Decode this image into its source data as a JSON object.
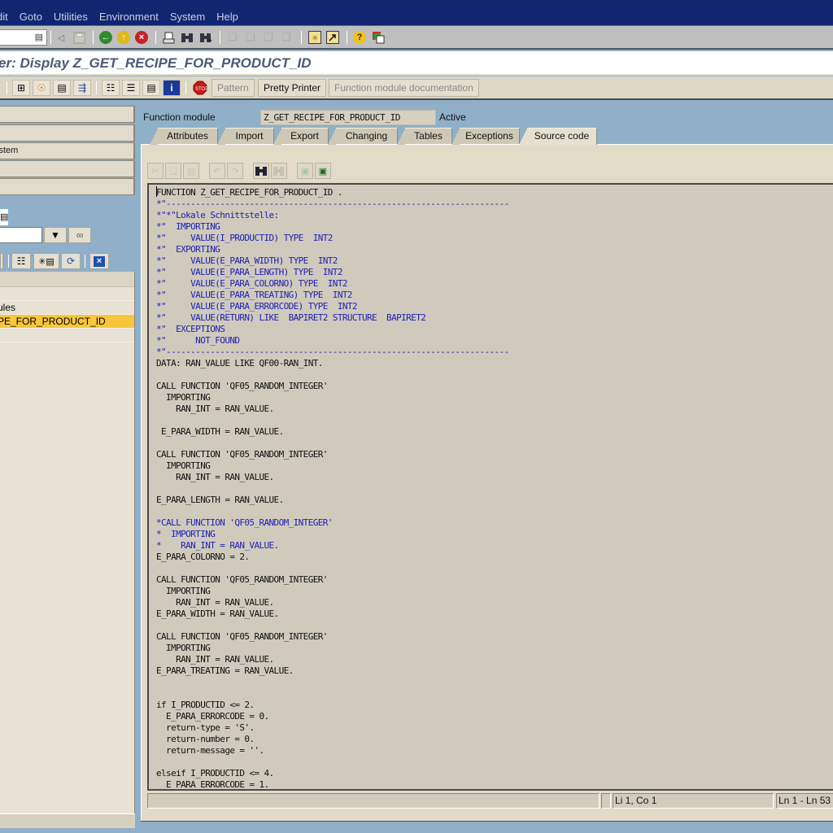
{
  "menubar": {
    "items": [
      "dit",
      "Goto",
      "Utilities",
      "Environment",
      "System",
      "Help"
    ]
  },
  "system_toolbar": {
    "command_field_value": "",
    "icons": [
      "command-dropdown-icon",
      "back-arrow-small-icon",
      "save-icon",
      "back-icon",
      "exit-icon",
      "cancel-icon",
      "print-icon",
      "find-icon",
      "find-next-icon",
      "first-page-icon",
      "previous-page-icon",
      "next-page-icon",
      "last-page-icon",
      "create-session-icon",
      "shortcut-icon",
      "help-icon",
      "layout-menu-icon"
    ]
  },
  "title": "er: Display Z_GET_RECIPE_FOR_PRODUCT_ID",
  "app_toolbar": {
    "buttons": {
      "pattern": "Pattern",
      "pretty_printer": "Pretty Printer",
      "fm_documentation": "Function module documentation"
    }
  },
  "left_panel": {
    "buttons": [
      "",
      "",
      "ystem",
      "",
      ""
    ],
    "tree_rows": [
      {
        "label": "",
        "selected": false
      },
      {
        "label": "ules",
        "selected": false
      },
      {
        "label": "PE_FOR_PRODUCT_ID",
        "selected": true
      },
      {
        "label": "",
        "selected": false
      }
    ],
    "combo_value": ""
  },
  "header": {
    "function_module_label": "Function module",
    "function_module_value": "Z_GET_RECIPE_FOR_PRODUCT_ID",
    "status": "Active"
  },
  "tabs": [
    {
      "label": "Attributes",
      "active": false
    },
    {
      "label": "Import",
      "active": false
    },
    {
      "label": "Export",
      "active": false
    },
    {
      "label": "Changing",
      "active": false
    },
    {
      "label": "Tables",
      "active": false
    },
    {
      "label": "Exceptions",
      "active": false
    },
    {
      "label": "Source code",
      "active": true
    }
  ],
  "source_code": [
    {
      "text": "FUNCTION Z_GET_RECIPE_FOR_PRODUCT_ID .",
      "comment": false
    },
    {
      "text": "*\"----------------------------------------------------------------------",
      "comment": true
    },
    {
      "text": "*\"*\"Lokale Schnittstelle:",
      "comment": true
    },
    {
      "text": "*\"  IMPORTING",
      "comment": true
    },
    {
      "text": "*\"     VALUE(I_PRODUCTID) TYPE  INT2",
      "comment": true
    },
    {
      "text": "*\"  EXPORTING",
      "comment": true
    },
    {
      "text": "*\"     VALUE(E_PARA_WIDTH) TYPE  INT2",
      "comment": true
    },
    {
      "text": "*\"     VALUE(E_PARA_LENGTH) TYPE  INT2",
      "comment": true
    },
    {
      "text": "*\"     VALUE(E_PARA_COLORNO) TYPE  INT2",
      "comment": true
    },
    {
      "text": "*\"     VALUE(E_PARA_TREATING) TYPE  INT2",
      "comment": true
    },
    {
      "text": "*\"     VALUE(E_PARA_ERRORCODE) TYPE  INT2",
      "comment": true
    },
    {
      "text": "*\"     VALUE(RETURN) LIKE  BAPIRET2 STRUCTURE  BAPIRET2",
      "comment": true
    },
    {
      "text": "*\"  EXCEPTIONS",
      "comment": true
    },
    {
      "text": "*\"      NOT_FOUND",
      "comment": true
    },
    {
      "text": "*\"----------------------------------------------------------------------",
      "comment": true
    },
    {
      "text": "DATA: RAN_VALUE LIKE QF00-RAN_INT.",
      "comment": false
    },
    {
      "text": "",
      "comment": false
    },
    {
      "text": "CALL FUNCTION 'QF05_RANDOM_INTEGER'",
      "comment": false
    },
    {
      "text": "  IMPORTING",
      "comment": false
    },
    {
      "text": "    RAN_INT = RAN_VALUE.",
      "comment": false
    },
    {
      "text": "",
      "comment": false
    },
    {
      "text": " E_PARA_WIDTH = RAN_VALUE.",
      "comment": false
    },
    {
      "text": "",
      "comment": false
    },
    {
      "text": "CALL FUNCTION 'QF05_RANDOM_INTEGER'",
      "comment": false
    },
    {
      "text": "  IMPORTING",
      "comment": false
    },
    {
      "text": "    RAN_INT = RAN_VALUE.",
      "comment": false
    },
    {
      "text": "",
      "comment": false
    },
    {
      "text": "E_PARA_LENGTH = RAN_VALUE.",
      "comment": false
    },
    {
      "text": "",
      "comment": false
    },
    {
      "text": "*CALL FUNCTION 'QF05_RANDOM_INTEGER'",
      "comment": true
    },
    {
      "text": "*  IMPORTING",
      "comment": true
    },
    {
      "text": "*    RAN_INT = RAN_VALUE.",
      "comment": true
    },
    {
      "text": "E_PARA_COLORNO = 2.",
      "comment": false
    },
    {
      "text": "",
      "comment": false
    },
    {
      "text": "CALL FUNCTION 'QF05_RANDOM_INTEGER'",
      "comment": false
    },
    {
      "text": "  IMPORTING",
      "comment": false
    },
    {
      "text": "    RAN_INT = RAN_VALUE.",
      "comment": false
    },
    {
      "text": "E_PARA_WIDTH = RAN_VALUE.",
      "comment": false
    },
    {
      "text": "",
      "comment": false
    },
    {
      "text": "CALL FUNCTION 'QF05_RANDOM_INTEGER'",
      "comment": false
    },
    {
      "text": "  IMPORTING",
      "comment": false
    },
    {
      "text": "    RAN_INT = RAN_VALUE.",
      "comment": false
    },
    {
      "text": "E_PARA_TREATING = RAN_VALUE.",
      "comment": false
    },
    {
      "text": "",
      "comment": false
    },
    {
      "text": "",
      "comment": false
    },
    {
      "text": "if I_PRODUCTID <= 2.",
      "comment": false
    },
    {
      "text": "  E_PARA_ERRORCODE = 0.",
      "comment": false
    },
    {
      "text": "  return-type = 'S'.",
      "comment": false
    },
    {
      "text": "  return-number = 0.",
      "comment": false
    },
    {
      "text": "  return-message = ''.",
      "comment": false
    },
    {
      "text": "",
      "comment": false
    },
    {
      "text": "elseif I_PRODUCTID <= 4.",
      "comment": false
    },
    {
      "text": "  E_PARA_ERRORCODE = 1.",
      "comment": false
    }
  ],
  "statusbar": {
    "message": "",
    "cursor_position": "Li 1, Co 1",
    "line_range": "Ln 1 - Ln 53"
  },
  "colors": {
    "menubar_bg": "#112671",
    "comment_text": "#2020b8",
    "selected_row": "#f7c63b",
    "workspace_bg": "#8fb0c8"
  }
}
